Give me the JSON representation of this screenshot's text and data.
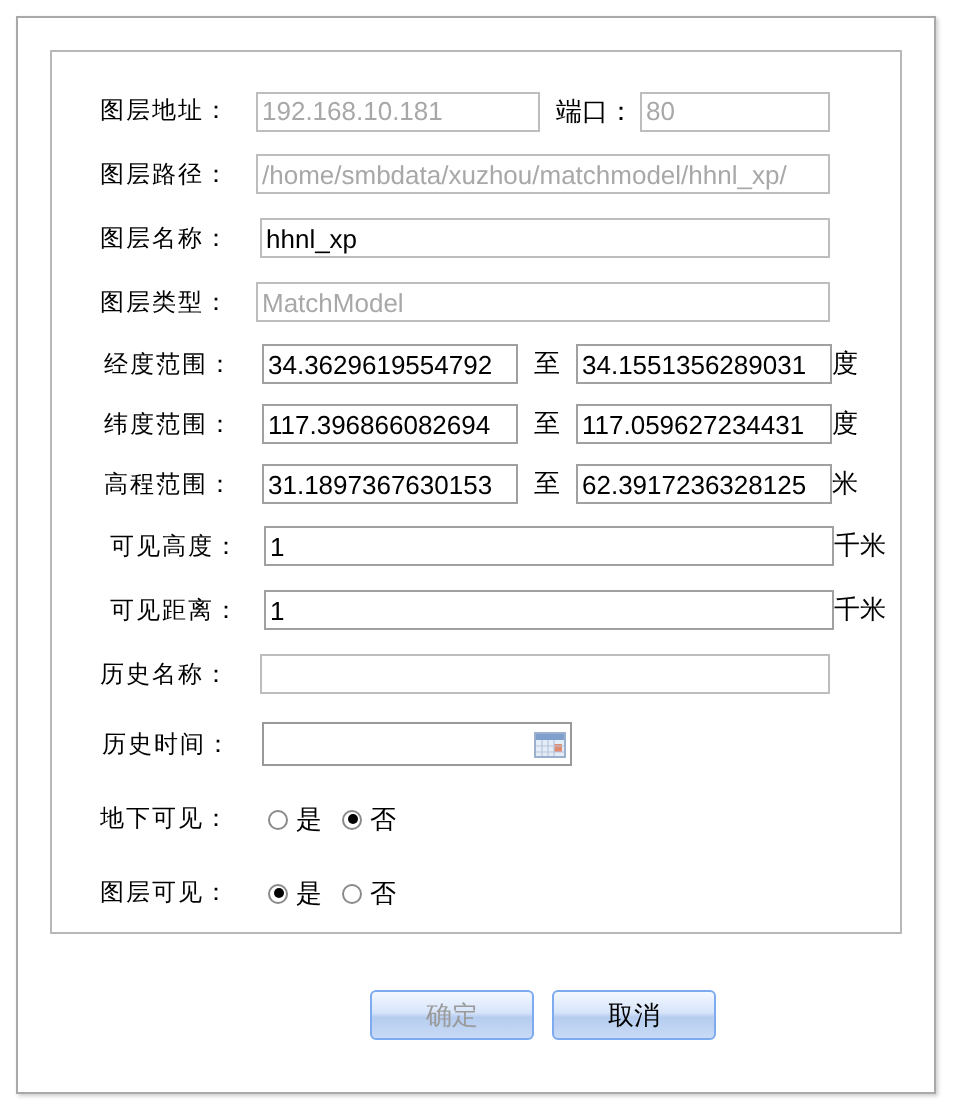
{
  "rows": [
    {
      "kind": "pair",
      "label": "图层地址：",
      "value": "192.168.10.181",
      "disabled": true,
      "second_label": "端口：",
      "second_value": "80",
      "second_disabled": true
    },
    {
      "kind": "text",
      "label": "图层路径：",
      "value": "/home/smbdata/xuzhou/matchmodel/hhnl_xp/",
      "disabled": true
    },
    {
      "kind": "text",
      "label": "图层名称：",
      "value": "hhnl_xp",
      "disabled": false
    },
    {
      "kind": "text",
      "label": "图层类型：",
      "value": "MatchModel",
      "disabled": true
    },
    {
      "kind": "range",
      "label": "经度范围：",
      "from": "34.3629619554792",
      "sep": "至",
      "to": "34.1551356289031",
      "unit": "度"
    },
    {
      "kind": "range",
      "label": "纬度范围：",
      "from": "117.396866082694",
      "sep": "至",
      "to": "117.059627234431",
      "unit": "度"
    },
    {
      "kind": "range",
      "label": "高程范围：",
      "from": "31.1897367630153",
      "sep": "至",
      "to": "62.3917236328125",
      "unit": "米"
    },
    {
      "kind": "unit",
      "label": "可见高度：",
      "value": "1",
      "unit": "千米"
    },
    {
      "kind": "unit",
      "label": "可见距离：",
      "value": "1",
      "unit": "千米"
    },
    {
      "kind": "text",
      "label": "历史名称：",
      "disabled": false
    },
    {
      "kind": "date",
      "label": "历史时间："
    },
    {
      "kind": "radio",
      "label": "地下可见：",
      "options": [
        {
          "label": "是",
          "selected": false
        },
        {
          "label": "否",
          "selected": true
        }
      ]
    },
    {
      "kind": "radio",
      "label": "图层可见：",
      "options": [
        {
          "label": "是",
          "selected": true
        },
        {
          "label": "否",
          "selected": false
        }
      ]
    }
  ],
  "buttons": [
    {
      "label": "确定",
      "disabled": true
    },
    {
      "label": "取消",
      "disabled": false
    }
  ]
}
